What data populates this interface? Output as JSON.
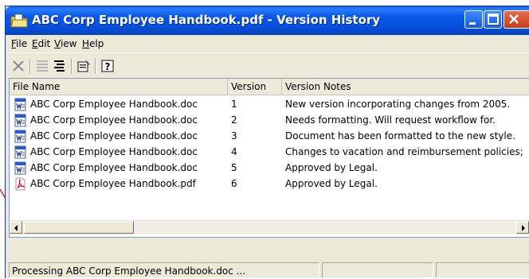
{
  "window": {
    "title": "ABC Corp Employee Handbook.pdf - Version History"
  },
  "menubar": {
    "items": [
      {
        "pre": "",
        "accel": "F",
        "post": "ile"
      },
      {
        "pre": "",
        "accel": "E",
        "post": "dit"
      },
      {
        "pre": "",
        "accel": "V",
        "post": "iew"
      },
      {
        "pre": "",
        "accel": "H",
        "post": "elp"
      }
    ]
  },
  "toolbar": {
    "buttons": [
      "delete-icon",
      "details-view-icon",
      "workflow-icon",
      "properties-icon",
      "help-icon"
    ]
  },
  "list": {
    "columns": [
      "File Name",
      "Version",
      "Version Notes"
    ],
    "rows": [
      {
        "icon": "word-document-icon",
        "name": "ABC Corp Employee Handbook.doc",
        "version": "1",
        "notes": "New version incorporating changes from 2005."
      },
      {
        "icon": "word-document-icon",
        "name": "ABC Corp Employee Handbook.doc",
        "version": "2",
        "notes": "Needs formatting. Will request workflow for."
      },
      {
        "icon": "word-document-icon",
        "name": "ABC Corp Employee Handbook.doc",
        "version": "3",
        "notes": "Document has been formatted to the new style."
      },
      {
        "icon": "word-document-icon",
        "name": "ABC Corp Employee Handbook.doc",
        "version": "4",
        "notes": "Changes to vacation and reimbursement policies;"
      },
      {
        "icon": "word-document-icon",
        "name": "ABC Corp Employee Handbook.doc",
        "version": "5",
        "notes": "Approved by Legal."
      },
      {
        "icon": "pdf-document-icon",
        "name": "ABC Corp Employee Handbook.pdf",
        "version": "6",
        "notes": "Approved by Legal."
      }
    ]
  },
  "statusbar": {
    "message": "Processing ABC Corp Employee Handbook.doc ..."
  },
  "colors": {
    "titlebar": "#0a58e6",
    "window_bg": "#ece9d8",
    "callout_arrow": "#c0282d"
  }
}
